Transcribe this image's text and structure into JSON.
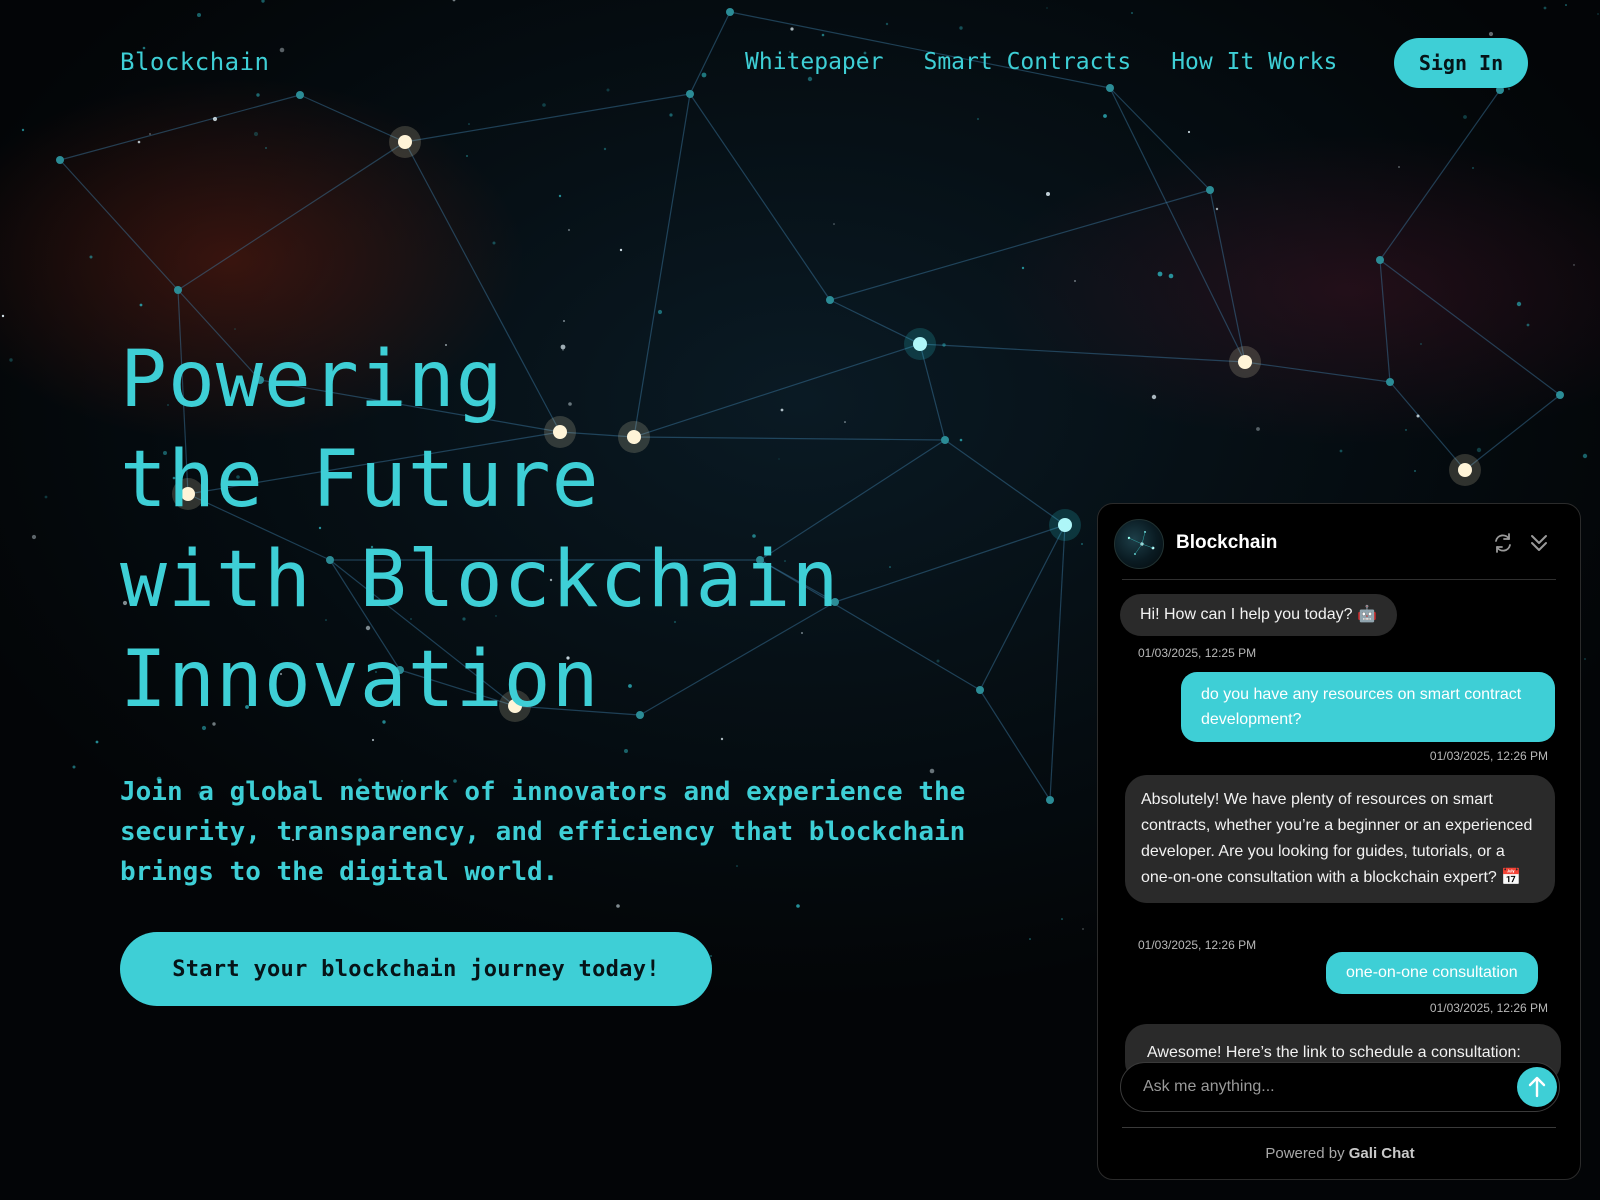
{
  "nav": {
    "brand": "Blockchain",
    "links": [
      "Whitepaper",
      "Smart Contracts",
      "How It Works"
    ],
    "signin_label": "Sign In"
  },
  "hero": {
    "title_lines": [
      "Powering",
      "the Future",
      "with Blockchain",
      "Innovation"
    ],
    "subtitle": "Join a global network of innovators and experience the security, transparency, and efficiency that blockchain brings to the digital world.",
    "cta_label": "Start your blockchain journey today!"
  },
  "chat": {
    "title": "Blockchain",
    "messages": [
      {
        "role": "bot",
        "text": "Hi! How can I help you today? 🤖",
        "time": "01/03/2025, 12:25 PM"
      },
      {
        "role": "user",
        "text": "do you have any resources on smart contract development?",
        "time": "01/03/2025, 12:26 PM"
      },
      {
        "role": "bot",
        "text": "Absolutely! We have plenty of resources on smart contracts, whether you’re a beginner or an experienced developer. Are you looking for guides, tutorials, or a one-on-one consultation with a blockchain expert? 📅",
        "time": "01/03/2025, 12:26 PM"
      },
      {
        "role": "user",
        "text": "one-on-one consultation",
        "time": "01/03/2025, 12:26 PM"
      },
      {
        "role": "bot",
        "text": "Awesome! Here’s the link to schedule a consultation:",
        "time": ""
      }
    ],
    "input_placeholder": "Ask me anything...",
    "powered_prefix": "Powered by",
    "powered_brand": "Gali Chat"
  },
  "colors": {
    "accent": "#3ecfd6",
    "background": "#040608",
    "bot_bubble": "#2a2a2a",
    "panel": "#000000"
  },
  "icons": {
    "refresh": "refresh-icon",
    "collapse": "chevrons-down-icon",
    "send": "arrow-up-icon"
  }
}
